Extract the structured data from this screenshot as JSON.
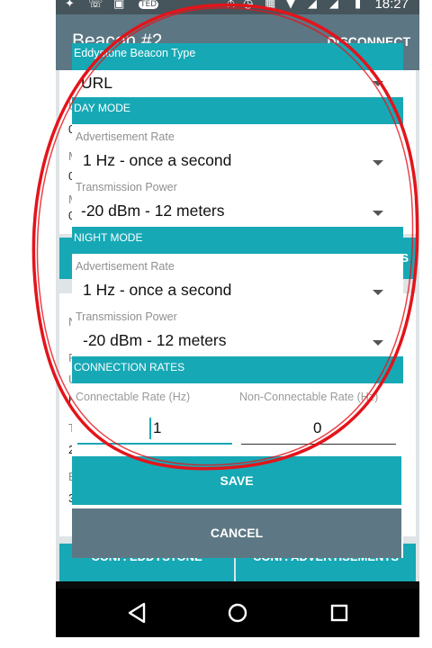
{
  "status_bar": {
    "time": "18:27",
    "left_icons": [
      "twitter-icon",
      "whatsapp-icon",
      "image-icon",
      "ted-icon"
    ],
    "right_icons": [
      "bluetooth-icon",
      "alarm-icon",
      "vibrate-icon",
      "wifi-icon",
      "signal-icon",
      "battery-icon"
    ],
    "ted_text": "TED"
  },
  "app_bar": {
    "title": "Beacon #2",
    "action": "DISCONNECT"
  },
  "background": {
    "row_fragments": [
      "U",
      "0",
      "M",
      "0",
      "M",
      "0"
    ],
    "card2_fragments": [
      "N",
      "FA",
      "U",
      "h",
      "T",
      "2",
      "B",
      "3"
    ],
    "button_fragment": "S",
    "conf_eddystone": "CONF. EDDYSTONE",
    "conf_advertisements": "CONF. ADVERTISEMENTS"
  },
  "dialog": {
    "beacon_type": {
      "header": "Eddystone Beacon Type",
      "value": "URL"
    },
    "day_mode": {
      "header": "DAY MODE",
      "adv_label": "Advertisement Rate",
      "adv_value": "1 Hz - once a second",
      "power_label": "Transmission Power",
      "power_value": "-20 dBm - 12 meters"
    },
    "night_mode": {
      "header": "NIGHT MODE",
      "adv_label": "Advertisement Rate",
      "adv_value": "1 Hz - once a second",
      "power_label": "Transmission Power",
      "power_value": "-20 dBm - 12 meters"
    },
    "connection_rates": {
      "header": "CONNECTION RATES",
      "connectable_label": "Connectable Rate (Hz)",
      "connectable_value": "1",
      "non_connectable_label": "Non-Connectable Rate (Hz)",
      "non_connectable_value": "0"
    },
    "save_label": "SAVE",
    "cancel_label": "CANCEL"
  },
  "colors": {
    "accent": "#17a8b5",
    "app_bar": "#5c7683",
    "cancel_button": "#5d7884",
    "annotation": "#e3141b"
  }
}
